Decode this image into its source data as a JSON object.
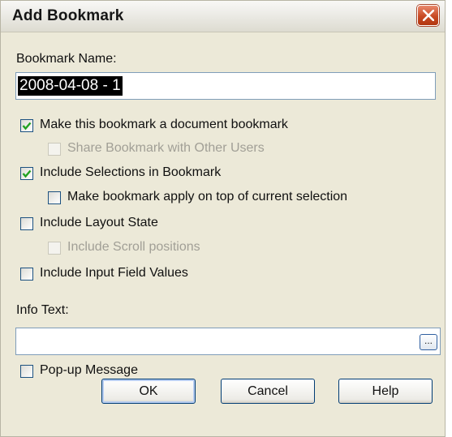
{
  "dialog": {
    "title": "Add Bookmark",
    "close_symbol": "close-icon"
  },
  "bookmark_name": {
    "label": "Bookmark Name:",
    "value": "2008-04-08 - 1"
  },
  "options": {
    "doc_bookmark": {
      "label": "Make this bookmark a document bookmark",
      "checked": true,
      "enabled": true
    },
    "share": {
      "label": "Share Bookmark with Other Users",
      "checked": false,
      "enabled": false
    },
    "include_selections": {
      "label": "Include Selections in Bookmark",
      "checked": true,
      "enabled": true
    },
    "apply_on_top": {
      "label": "Make bookmark apply on top of current selection",
      "checked": false,
      "enabled": true
    },
    "layout_state": {
      "label": "Include Layout State",
      "checked": false,
      "enabled": true
    },
    "scroll_positions": {
      "label": "Include Scroll positions",
      "checked": false,
      "enabled": false
    },
    "input_values": {
      "label": "Include Input Field Values",
      "checked": false,
      "enabled": true
    }
  },
  "info_text": {
    "label": "Info Text:",
    "value": "",
    "browse_label": "..."
  },
  "popup": {
    "label": "Pop-up Message",
    "checked": false
  },
  "buttons": {
    "ok": "OK",
    "cancel": "Cancel",
    "help": "Help"
  },
  "colors": {
    "check": "#21a121",
    "title_text": "#151515",
    "close_button": "#c84a24"
  }
}
